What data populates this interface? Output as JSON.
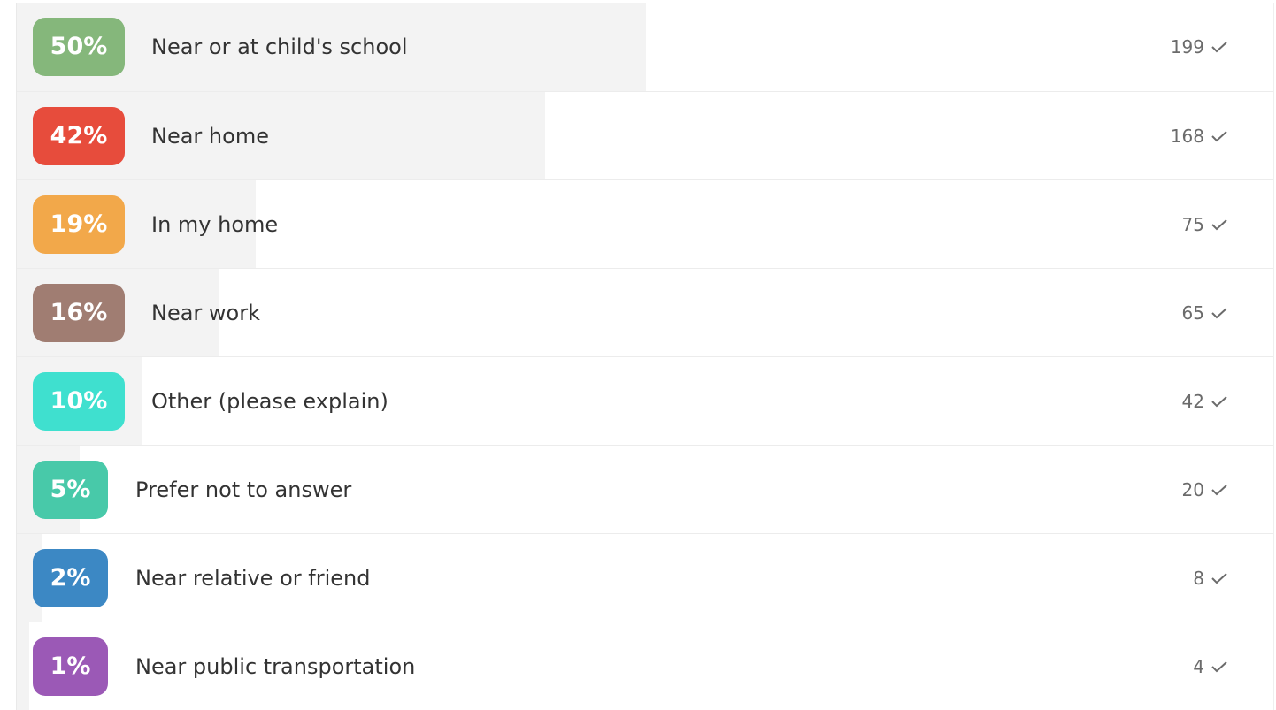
{
  "poll": {
    "options": [
      {
        "percent_label": "50%",
        "label": "Near or at child's school",
        "count": "199",
        "share": 0.5,
        "color": "#85b77b"
      },
      {
        "percent_label": "42%",
        "label": "Near home",
        "count": "168",
        "share": 0.42,
        "color": "#e74c3c"
      },
      {
        "percent_label": "19%",
        "label": "In my home",
        "count": "75",
        "share": 0.19,
        "color": "#f2a84a"
      },
      {
        "percent_label": "16%",
        "label": "Near work",
        "count": "65",
        "share": 0.16,
        "color": "#a07d72"
      },
      {
        "percent_label": "10%",
        "label": "Other (please explain)",
        "count": "42",
        "share": 0.1,
        "color": "#3fe0cf"
      },
      {
        "percent_label": "5%",
        "label": "Prefer not to answer",
        "count": "20",
        "share": 0.05,
        "color": "#48c9a9"
      },
      {
        "percent_label": "2%",
        "label": "Near relative or friend",
        "count": "8",
        "share": 0.02,
        "color": "#3c88c4"
      },
      {
        "percent_label": "1%",
        "label": "Near public transportation",
        "count": "4",
        "share": 0.01,
        "color": "#9b59b6"
      }
    ],
    "check_icon": "check-icon"
  }
}
